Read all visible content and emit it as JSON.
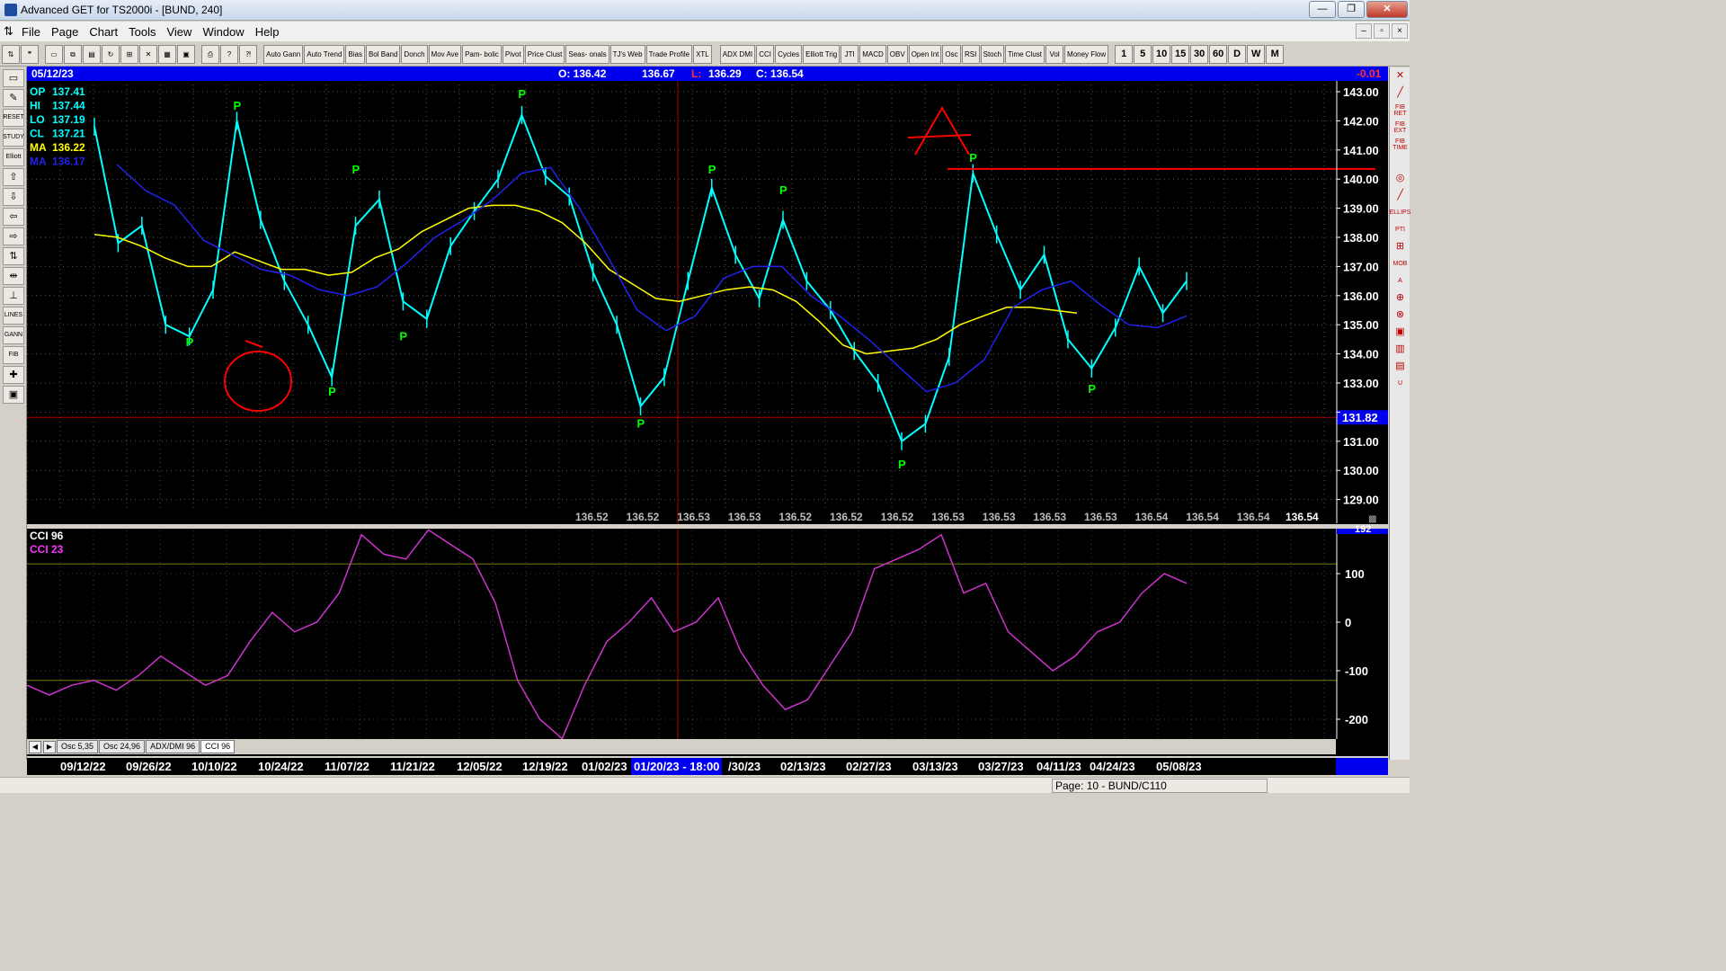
{
  "window": {
    "title": "Advanced GET for TS2000i - [BUND, 240]",
    "minimize": "—",
    "maximize": "❐",
    "close": "✕"
  },
  "menu": [
    "File",
    "Page",
    "Chart",
    "Tools",
    "View",
    "Window",
    "Help"
  ],
  "toolbar": {
    "studies": [
      "Auto Gann",
      "Auto Trend",
      "Bias",
      "Bol Band",
      "Donch",
      "Mov Ave",
      "Pam- bolic",
      "Pivot",
      "Price Clust",
      "Seas- onals",
      "TJ's Web",
      "Trade Profile",
      "XTL",
      "ADX DMI",
      "CCI",
      "Cycles",
      "Elliott Trig",
      "JTI",
      "MACD",
      "OBV",
      "Open Int",
      "Osc",
      "RSI",
      "Stoch",
      "Time Clust",
      "Vol",
      "Money Flow"
    ],
    "periods": [
      "1",
      "5",
      "10",
      "15",
      "30",
      "60",
      "D",
      "W",
      "M"
    ]
  },
  "left_tools": [
    "",
    "",
    "RESET",
    "STUDY",
    "Elliott",
    "",
    "",
    "",
    "",
    "",
    "",
    "",
    "LINES",
    "GANN",
    "FIB",
    "",
    ""
  ],
  "right_tools": [
    "",
    "",
    "FIB RET",
    "FIB EXT",
    "FIB TIME",
    "",
    "",
    "",
    "ELLIPS",
    "PTI",
    "",
    "MOB",
    "A",
    "",
    "",
    "",
    "",
    "",
    "U"
  ],
  "infobar": {
    "date": "05/12/23",
    "open": "O: 136.42",
    "high": "136.67",
    "low_label": "L:",
    "low": "136.29",
    "close": "C: 136.54",
    "change": "-0.01"
  },
  "legend": [
    {
      "label": "OP",
      "value": "137.41",
      "color": "#00ffff"
    },
    {
      "label": "HI",
      "value": "137.44",
      "color": "#00ffff"
    },
    {
      "label": "LO",
      "value": "137.19",
      "color": "#00ffff"
    },
    {
      "label": "CL",
      "value": "137.21",
      "color": "#00ffff"
    },
    {
      "label": "MA",
      "value": "136.22",
      "color": "#ffff00"
    },
    {
      "label": "MA",
      "value": "136.17",
      "color": "#2222ee"
    }
  ],
  "cci_legend": [
    {
      "label": "CCI 96",
      "color": "#ffffff"
    },
    {
      "label": "CCI  23",
      "color": "#ff33ff"
    }
  ],
  "tabs": [
    "Osc 5,35",
    "Osc 24,96",
    "ADX/DMI 96",
    "CCI 96"
  ],
  "active_tab": "CCI 96",
  "dates": [
    "09/12/22",
    "09/26/22",
    "10/10/22",
    "10/24/22",
    "11/07/22",
    "11/21/22",
    "12/05/22",
    "12/19/22",
    "01/02/23",
    "01/20/23 - 18:00",
    "/30/23",
    "02/13/23",
    "02/27/23",
    "03/13/23",
    "03/27/23",
    "04/11/23",
    "04/24/23",
    "05/08/23"
  ],
  "cursor_date": "01/20/23 - 18:00",
  "status": "Page: 10 - BUND/C110",
  "colors": {
    "price": "#00ffff",
    "ma_fast": "#ffff00",
    "ma_slow": "#2222ee",
    "pivot": "#00ff00",
    "cci": "#cc33cc",
    "annotation": "#ff0000"
  },
  "chart_data": [
    {
      "type": "line",
      "title": "",
      "ylim": [
        128.5,
        143.0
      ],
      "y_ticks": [
        "143.00",
        "142.00",
        "141.00",
        "140.00",
        "139.00",
        "138.00",
        "137.00",
        "136.00",
        "135.00",
        "134.00",
        "133.00",
        "132.00",
        "131.00",
        "130.00",
        "129.00"
      ],
      "horizontal_line": {
        "value": 131.82,
        "label": "131.82"
      },
      "resistance_line": 140.35,
      "cursor_row_values": [
        "136.52",
        "136.52",
        "136.53",
        "136.53",
        "136.52",
        "136.52",
        "136.52",
        "136.53",
        "136.53",
        "136.53",
        "136.53",
        "136.54",
        "136.54",
        "136.54"
      ],
      "cursor_value": "136.54",
      "pivot_label": "P",
      "pivots": [
        {
          "bar": 4,
          "price": 134.7,
          "type": "low"
        },
        {
          "bar": 6,
          "price": 142.2,
          "type": "high"
        },
        {
          "bar": 10,
          "price": 133.0,
          "type": "low"
        },
        {
          "bar": 11,
          "price": 140.0,
          "type": "high"
        },
        {
          "bar": 13,
          "price": 134.9,
          "type": "low"
        },
        {
          "bar": 18,
          "price": 142.6,
          "type": "high"
        },
        {
          "bar": 23,
          "price": 131.9,
          "type": "low"
        },
        {
          "bar": 26,
          "price": 140.0,
          "type": "high"
        },
        {
          "bar": 29,
          "price": 139.3,
          "type": "high"
        },
        {
          "bar": 34,
          "price": 130.5,
          "type": "low"
        },
        {
          "bar": 37,
          "price": 140.4,
          "type": "high"
        },
        {
          "bar": 42,
          "price": 133.1,
          "type": "low"
        }
      ],
      "series": [
        {
          "values": [
            141.8,
            137.8,
            138.4,
            135.0,
            134.6,
            136.2,
            142.0,
            138.6,
            136.5,
            135.0,
            133.2,
            138.4,
            139.3,
            135.8,
            135.2,
            137.7,
            138.9,
            140.0,
            142.2,
            140.1,
            139.4,
            136.8,
            135.0,
            132.2,
            133.2,
            136.5,
            139.7,
            137.4,
            135.9,
            138.6,
            136.5,
            135.5,
            134.1,
            133.0,
            131.0,
            131.6,
            133.9,
            140.2,
            138.1,
            136.2,
            137.4,
            134.5,
            133.5,
            134.9,
            137.0,
            135.4,
            136.5
          ]
        },
        {
          "name": "MA",
          "values": [
            138.1,
            138.0,
            137.7,
            137.3,
            137.0,
            137.0,
            137.5,
            137.2,
            136.9,
            136.9,
            136.7,
            136.8,
            137.3,
            137.6,
            138.2,
            138.6,
            139.0,
            139.1,
            139.1,
            138.9,
            138.5,
            137.8,
            136.9,
            136.4,
            135.9,
            135.8,
            136.0,
            136.2,
            136.3,
            136.2,
            135.8,
            135.1,
            134.3,
            134.0,
            134.1,
            134.2,
            134.5,
            135.0,
            135.3,
            135.6,
            135.6,
            135.5,
            135.4
          ]
        },
        {
          "name": "MA",
          "values": [
            140.5,
            139.6,
            139.1,
            137.9,
            137.4,
            136.9,
            136.7,
            136.2,
            136.0,
            136.3,
            137.1,
            138.0,
            138.6,
            139.3,
            140.2,
            140.4,
            139.0,
            137.3,
            135.5,
            134.8,
            135.3,
            136.6,
            137.0,
            137.0,
            136.0,
            135.3,
            134.5,
            133.6,
            132.7,
            133.0,
            133.8,
            135.6,
            136.2,
            136.5,
            135.7,
            135.0,
            134.9,
            135.3
          ]
        }
      ]
    },
    {
      "type": "line",
      "title": "CCI 96",
      "ylim": [
        -240,
        200
      ],
      "y_ticks": [
        "192",
        "100",
        "0",
        "-100",
        "-200"
      ],
      "reference_lines": [
        120,
        -120
      ],
      "series": [
        {
          "name": "CCI 96",
          "values": [
            -130,
            -150,
            -130,
            -120,
            -140,
            -110,
            -70,
            -100,
            -130,
            -110,
            -40,
            20,
            -20,
            0,
            60,
            180,
            140,
            130,
            190,
            160,
            130,
            40,
            -120,
            -200,
            -240,
            -130,
            -40,
            0,
            50,
            -20,
            0,
            50,
            -60,
            -130,
            -180,
            -160,
            -90,
            -20,
            110,
            130,
            150,
            180,
            60,
            80,
            -20,
            -60,
            -100,
            -70,
            -20,
            0,
            60,
            100,
            80
          ]
        }
      ]
    }
  ]
}
